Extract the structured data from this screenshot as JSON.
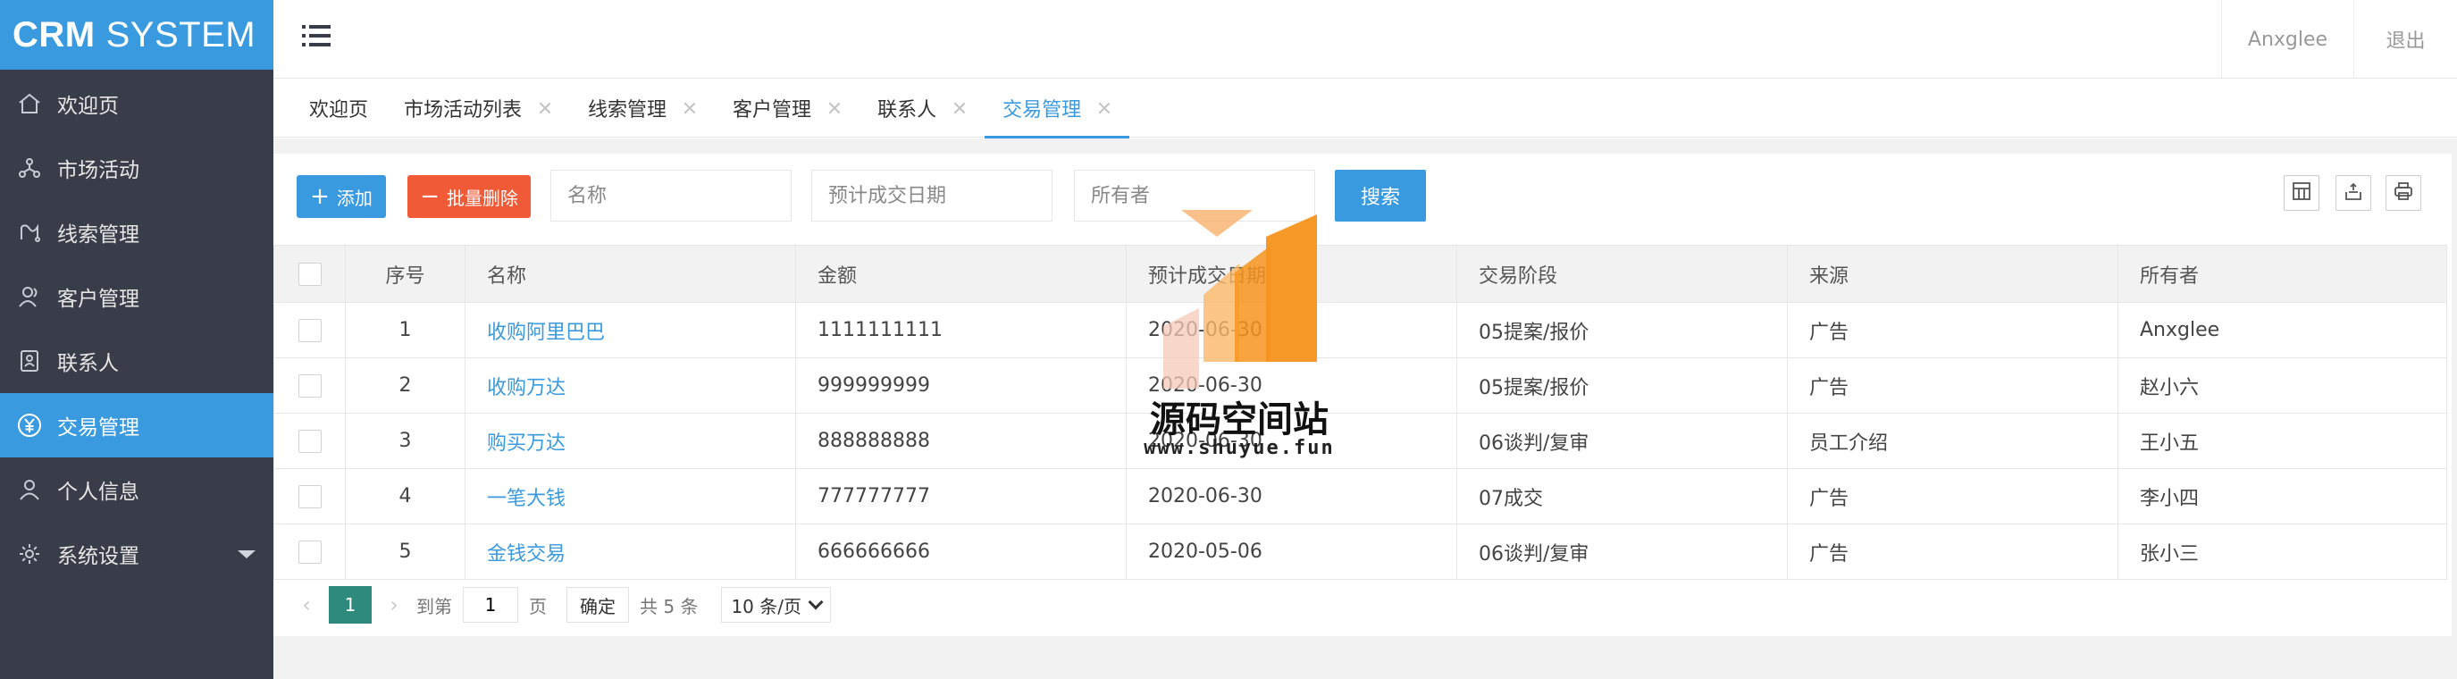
{
  "app": {
    "logo_bold": "CRM",
    "logo_rest": "SYSTEM",
    "accent_color": "#3a9ae0"
  },
  "sidebar": {
    "items": [
      {
        "label": "欢迎页",
        "icon": "home-icon"
      },
      {
        "label": "市场活动",
        "icon": "network-icon"
      },
      {
        "label": "线索管理",
        "icon": "clue-icon"
      },
      {
        "label": "客户管理",
        "icon": "customer-icon"
      },
      {
        "label": "联系人",
        "icon": "contact-card-icon"
      },
      {
        "label": "交易管理",
        "icon": "yen-icon",
        "active": true
      },
      {
        "label": "个人信息",
        "icon": "user-icon"
      },
      {
        "label": "系统设置",
        "icon": "gear-icon",
        "has_submenu": true
      }
    ]
  },
  "header": {
    "user": "Anxglee",
    "logout": "退出"
  },
  "tabs": [
    {
      "label": "欢迎页",
      "closable": false
    },
    {
      "label": "市场活动列表",
      "closable": true
    },
    {
      "label": "线索管理",
      "closable": true
    },
    {
      "label": "客户管理",
      "closable": true
    },
    {
      "label": "联系人",
      "closable": true
    },
    {
      "label": "交易管理",
      "closable": true,
      "active": true
    }
  ],
  "toolbar": {
    "add_label": "添加",
    "batch_delete_label": "批量删除",
    "name_placeholder": "名称",
    "date_placeholder": "预计成交日期",
    "owner_placeholder": "所有者",
    "search_label": "搜索"
  },
  "table": {
    "headers": [
      "序号",
      "名称",
      "金额",
      "预计成交日期",
      "交易阶段",
      "来源",
      "所有者"
    ],
    "rows": [
      [
        "1",
        "收购阿里巴巴",
        "1111111111",
        "2020-06-30",
        "05提案/报价",
        "广告",
        "Anxglee"
      ],
      [
        "2",
        "收购万达",
        "999999999",
        "2020-06-30",
        "05提案/报价",
        "广告",
        "赵小六"
      ],
      [
        "3",
        "购买万达",
        "888888888",
        "2020-06-30",
        "06谈判/复审",
        "员工介绍",
        "王小五"
      ],
      [
        "4",
        "一笔大钱",
        "777777777",
        "2020-06-30",
        "07成交",
        "广告",
        "李小四"
      ],
      [
        "5",
        "金钱交易",
        "666666666",
        "2020-05-06",
        "06谈判/复审",
        "广告",
        "张小三"
      ]
    ]
  },
  "pager": {
    "current_page": "1",
    "goto_label": "到第",
    "goto_value": "1",
    "page_unit": "页",
    "confirm_label": "确定",
    "total_label": "共 5 条",
    "page_size": "10 条/页"
  },
  "watermark": {
    "title": "源码空间站",
    "url": "www.shuyue.fun"
  }
}
